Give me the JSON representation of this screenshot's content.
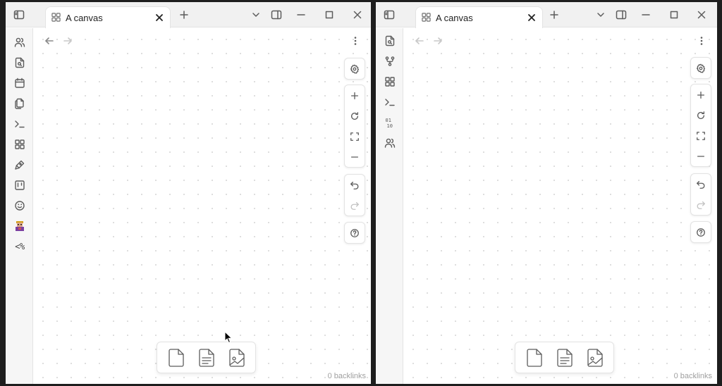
{
  "windows": [
    {
      "tab": {
        "title": "A canvas",
        "icon": "canvas-icon"
      },
      "ribbon": [
        "users-icon",
        "file-search-icon",
        "calendar-icon",
        "files-icon",
        "terminal-icon",
        "dashboard-icon",
        "pen-icon",
        "kanban-icon",
        "smiley-icon",
        "avatar-icon",
        "template-icon"
      ],
      "ribbon_text": "<%",
      "backlinks": "0 backlinks"
    },
    {
      "tab": {
        "title": "A canvas",
        "icon": "canvas-icon"
      },
      "ribbon": [
        "file-search-icon",
        "git-branch-icon",
        "dashboard-icon",
        "terminal-icon",
        "binary-icon",
        "users-icon"
      ],
      "backlinks": "0 backlinks"
    }
  ],
  "canvas_controls": [
    "settings-icon",
    "zoom-in-icon",
    "reset-zoom-icon",
    "fit-view-icon",
    "zoom-out-icon",
    "undo-icon",
    "redo-icon",
    "help-icon"
  ],
  "card_bar": [
    "new-note-card-icon",
    "add-file-card-icon",
    "add-media-card-icon"
  ],
  "ribbon_labels": {
    "binary_top": "01",
    "binary_bottom": "10"
  },
  "colors": {
    "background": "#ffffff",
    "titlebar": "#f1f1f1",
    "ribbon": "#f6f6f6",
    "grid_dot": "#d6d6d6",
    "border": "#e3e3e3"
  }
}
